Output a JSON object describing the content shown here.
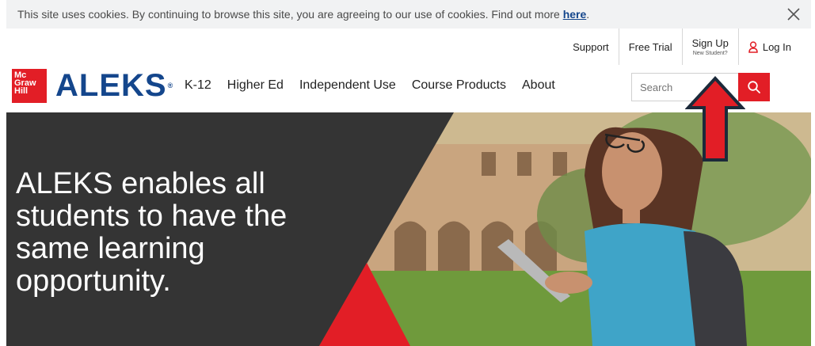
{
  "cookie_bar": {
    "text": "This site uses cookies. By continuing to browse this site, you are agreeing to our use of cookies. Find out more ",
    "link": "here",
    "suffix": "."
  },
  "utility_nav": {
    "support": "Support",
    "free_trial": "Free Trial",
    "sign_up": "Sign Up",
    "sign_up_sub": "New Student?",
    "log_in": "Log In"
  },
  "logo": {
    "lines": [
      "Mc",
      "Graw",
      "Hill"
    ],
    "brand": "ALEKS",
    "reg_mark": "®"
  },
  "main_nav": {
    "items": [
      "K-12",
      "Higher Ed",
      "Independent Use",
      "Course Products",
      "About"
    ]
  },
  "search": {
    "placeholder": "Search"
  },
  "hero": {
    "headline": "ALEKS enables all students to have the same learning opportunity."
  },
  "colors": {
    "brand_blue": "#14468c",
    "accent_red": "#e21e26",
    "hero_dark": "#343434"
  },
  "icons": {
    "close": "close-icon",
    "user": "user-icon",
    "search": "search-icon",
    "annotation": "red-up-arrow-icon"
  }
}
